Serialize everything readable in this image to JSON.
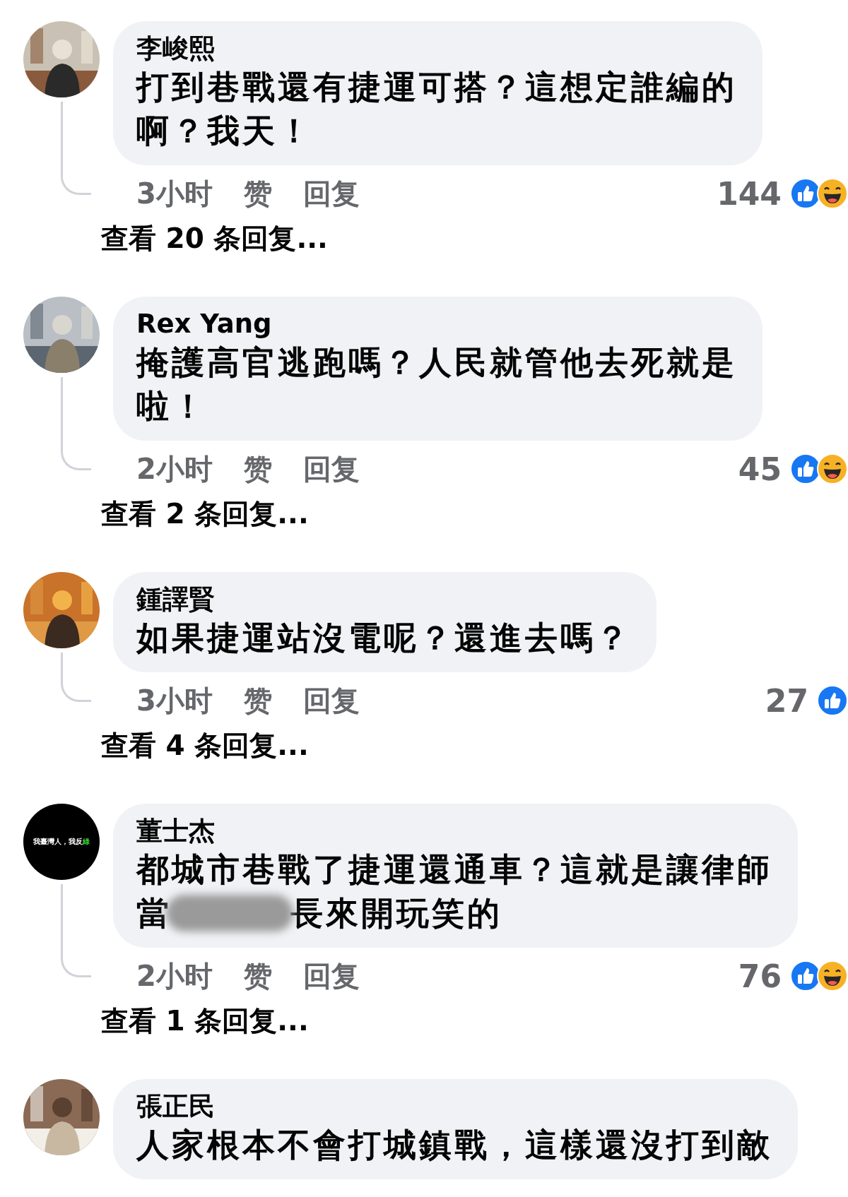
{
  "comments": [
    {
      "avatar": {
        "kind": "picture"
      },
      "name": "李峻熙",
      "lines": [
        [
          "打到巷戰還有捷運可搭？這想定誰編的"
        ],
        [
          "啊？我天！"
        ]
      ],
      "time": "3小时",
      "like": "赞",
      "reply": "回复",
      "count": "144",
      "reactions": [
        {
          "kind": "like"
        },
        {
          "kind": "haha"
        }
      ],
      "view_replies": "查看 20 条回复..."
    },
    {
      "avatar": {
        "kind": "picture"
      },
      "name": "Rex Yang",
      "lines": [
        [
          "掩護高官逃跑嗎？人民就管他去死就是"
        ],
        [
          "啦！"
        ]
      ],
      "time": "2小时",
      "like": "赞",
      "reply": "回复",
      "count": "45",
      "reactions": [
        {
          "kind": "like"
        },
        {
          "kind": "haha"
        }
      ],
      "view_replies": "查看 2 条回复..."
    },
    {
      "avatar": {
        "kind": "picture"
      },
      "name": "鍾譯賢",
      "lines": [
        [
          "如果捷運站沒電呢？還進去嗎？"
        ]
      ],
      "time": "3小时",
      "like": "赞",
      "reply": "回复",
      "count": "27",
      "reactions": [
        {
          "kind": "like"
        }
      ],
      "view_replies": "查看 4 条回复..."
    },
    {
      "avatar": {
        "kind": "text",
        "parts": [
          "我臺灣人，我反",
          "綠"
        ]
      },
      "name": "董士杰",
      "lines": [
        [
          "都城市巷戰了捷運還通車？這就是讓律師"
        ],
        [
          "當",
          "長來開玩笑的"
        ]
      ],
      "time": "2小时",
      "like": "赞",
      "reply": "回复",
      "count": "76",
      "reactions": [
        {
          "kind": "like"
        },
        {
          "kind": "haha"
        }
      ],
      "view_replies": "查看 1 条回复..."
    },
    {
      "avatar": {
        "kind": "picture"
      },
      "name": "張正民",
      "lines": [
        [
          "人家根本不會打城鎮戰，這樣還沒打到敵"
        ]
      ]
    }
  ]
}
